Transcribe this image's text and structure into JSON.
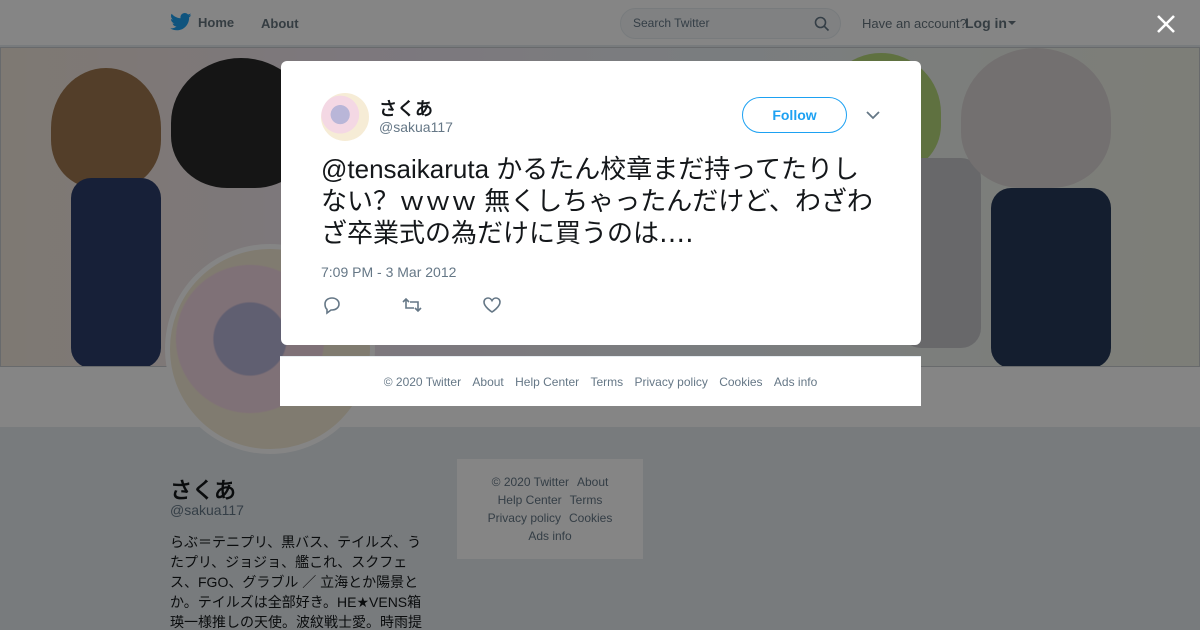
{
  "nav": {
    "home_label": "Home",
    "about_label": "About",
    "search_placeholder": "Search Twitter",
    "have_account": "Have an account?",
    "login_label": "Log in"
  },
  "profile": {
    "name": "さくあ",
    "handle": "@sakua117",
    "bio": "らぶ＝テニプリ、黒バス、テイルズ、うたプリ、ジョジョ、艦これ、スクフェス、FGO、グラブル ／ 立海とか陽景とか。テイルズは全部好き。HE★VENS箱瑛一様推しの天使。波紋戦士愛。時雨提"
  },
  "sidebar_footer": {
    "rows": [
      [
        "© 2020 Twitter",
        "About"
      ],
      [
        "Help Center",
        "Terms"
      ],
      [
        "Privacy policy",
        "Cookies"
      ],
      [
        "Ads info"
      ]
    ]
  },
  "modal": {
    "name": "さくあ",
    "handle": "@sakua117",
    "follow_label": "Follow",
    "tweet_text": "@tensaikaruta かるたん校章まだ持ってたりしない？ｗｗｗ 無くしちゃったんだけど、わざわざ卒業式の為だけに買うのは‥‥",
    "timestamp": "7:09 PM - 3 Mar 2012",
    "footer": [
      "© 2020 Twitter",
      "About",
      "Help Center",
      "Terms",
      "Privacy policy",
      "Cookies",
      "Ads info"
    ]
  },
  "colors": {
    "accent": "#1da1f2",
    "overlay": "rgba(0,0,0,0.48)"
  },
  "icons": [
    "twitter-bird-icon",
    "home-icon",
    "search-icon",
    "close-icon",
    "chevron-down-icon",
    "reply-icon",
    "retweet-icon",
    "like-icon"
  ]
}
